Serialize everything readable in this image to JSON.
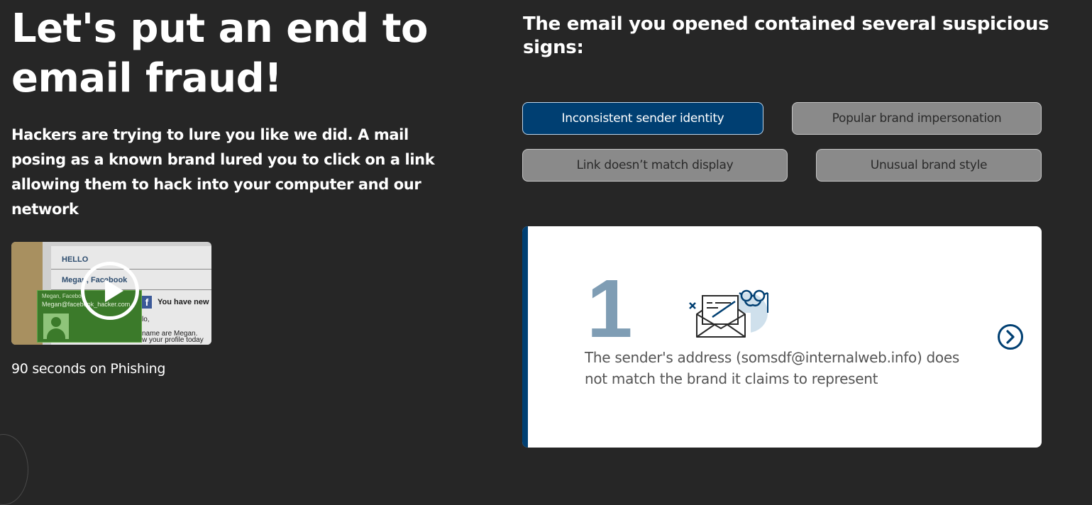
{
  "left": {
    "title": "Let's put an end to email fraud!",
    "lead": "Hackers are trying to lure you like we did. A mail posing as a known brand lured you to click on a link allowing them to hack into your computer and our network",
    "video": {
      "caption": "90 seconds on Phishing",
      "thumbnail": {
        "hello": "HELLO",
        "from": "Megan, Facebook",
        "message": "You have new",
        "fb_logo": "f",
        "line1": "lo,",
        "line2": "name are Megan.",
        "line3": "w your profile today",
        "card_name": "Megan, Facebo",
        "card_email": "Megan@facebook_hacker.com"
      }
    }
  },
  "right": {
    "title": "The email you opened contained several suspicious signs:",
    "tags": [
      {
        "label": "Inconsistent sender identity",
        "active": true
      },
      {
        "label": "Popular brand impersonation",
        "active": false
      },
      {
        "label": "Link doesn’t match display",
        "active": false
      },
      {
        "label": "Unusual brand style",
        "active": false
      }
    ],
    "card": {
      "step_number": "1",
      "text": "The sender's address (somsdf@internalweb.info) does not match the brand it claims to represent"
    }
  },
  "colors": {
    "background": "#262626",
    "accent": "#003f72",
    "inactive_tag": "#8a8a8a",
    "step_number": "#7f9db4"
  },
  "icons": {
    "play": "play-circle-icon",
    "envelope": "open-envelope-disguise-icon",
    "next": "chevron-right-circle-icon"
  }
}
